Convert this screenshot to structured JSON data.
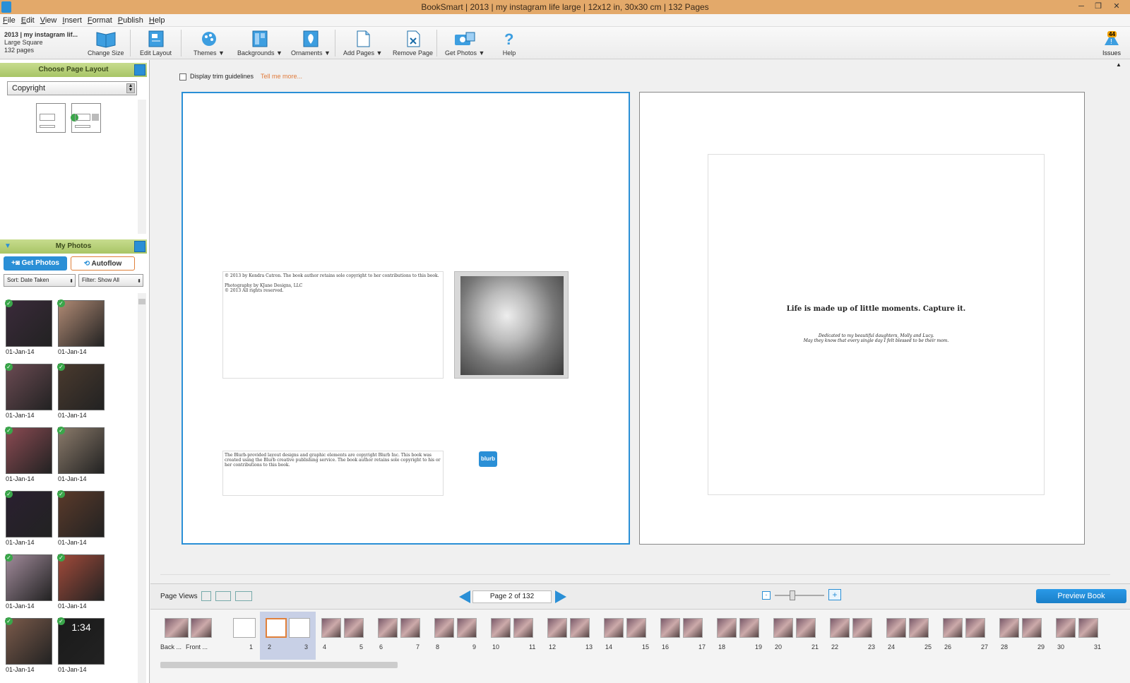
{
  "window": {
    "title": "BookSmart  |  2013 | my instagram life large  |  12x12 in, 30x30 cm  |  132 Pages"
  },
  "menu": [
    "File",
    "Edit",
    "View",
    "Insert",
    "Format",
    "Publish",
    "Help"
  ],
  "book": {
    "name": "2013 | my instagram lif...",
    "size": "Large Square",
    "pages": "132 pages"
  },
  "toolbar": {
    "change_size": "Change Size",
    "edit_layout": "Edit Layout",
    "themes": "Themes ▼",
    "backgrounds": "Backgrounds ▼",
    "ornaments": "Ornaments ▼",
    "add_pages": "Add Pages ▼",
    "remove_page": "Remove Page",
    "get_photos": "Get Photos ▼",
    "help": "Help",
    "issues": "Issues",
    "issues_count": "44"
  },
  "layout_panel": {
    "title": "Choose Page Layout",
    "selected": "Copyright"
  },
  "photos_panel": {
    "title": "My Photos",
    "get_photos": "Get Photos",
    "autoflow": "Autoflow",
    "sort": "Sort:  Date Taken",
    "filter": "Filter: Show All",
    "photos": [
      {
        "date": "01-Jan-14",
        "color": "#3a2a3a"
      },
      {
        "date": "01-Jan-14",
        "color": "#b08a74"
      },
      {
        "date": "01-Jan-14",
        "color": "#6a4a52"
      },
      {
        "date": "01-Jan-14",
        "color": "#4a3a2e"
      },
      {
        "date": "01-Jan-14",
        "color": "#8a4a52"
      },
      {
        "date": "01-Jan-14",
        "color": "#8a7a6a"
      },
      {
        "date": "01-Jan-14",
        "color": "#2a2030"
      },
      {
        "date": "01-Jan-14",
        "color": "#5a3a2a"
      },
      {
        "date": "01-Jan-14",
        "color": "#a08a9a"
      },
      {
        "date": "01-Jan-14",
        "color": "#a04a3a"
      },
      {
        "date": "01-Jan-14",
        "color": "#7a5a4a"
      },
      {
        "date": "01-Jan-14",
        "color": "#1a1a1a"
      }
    ],
    "clock_time": "1:34"
  },
  "canvas": {
    "trim_label": "Display trim guidelines",
    "tell_more": "Tell me more...",
    "copyright_lines": [
      "© 2013 by Kendra Catron.  The book author retains sole copyright to her contributions to this book.",
      "",
      "Photography by KJane Designs, LLC",
      "© 2013 All rights reserved."
    ],
    "blurb_notice": "The Blurb-provided layout designs and graphic elements are copyright Blurb Inc. This book was created using the Blurb creative publishing service. The book author retains sole copyright to his or her contributions to this book.",
    "blurb_logo": "blurb",
    "quote": "Life is made up of little moments.  Capture it.",
    "dedication_1": "Dedicated to my beautiful daughters, Molly and Lucy.",
    "dedication_2": "May they know that every single day I felt blessed to be their mom."
  },
  "bottom": {
    "page_views": "Page Views",
    "page_indicator": "Page 2 of 132",
    "preview": "Preview Book"
  },
  "filmstrip": {
    "labels": [
      "Back ...",
      "Front ...",
      "1",
      "2",
      "3",
      "4",
      "5",
      "6",
      "7",
      "8",
      "9",
      "10",
      "11",
      "12",
      "13",
      "14",
      "15",
      "16",
      "17",
      "18",
      "19",
      "20",
      "21",
      "22",
      "23",
      "24",
      "25",
      "26",
      "27",
      "28",
      "29",
      "30",
      "31"
    ]
  },
  "colors": {
    "accent": "#2a8fd6",
    "section_green": "#a8c566",
    "selected_border": "#2a8fd6",
    "title_bar": "#e3a96a"
  }
}
